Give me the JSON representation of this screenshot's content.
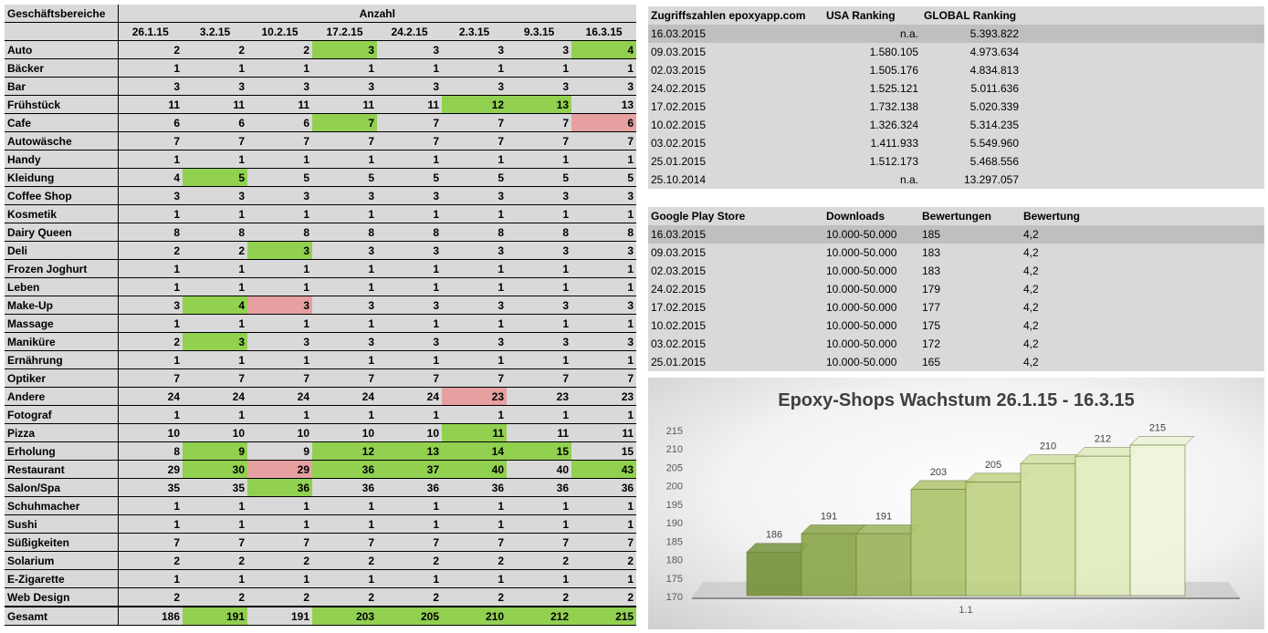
{
  "business_table": {
    "col_header": "Geschäftsbereiche",
    "group_header": "Anzahl",
    "dates": [
      "26.1.15",
      "3.2.15",
      "10.2.15",
      "17.2.15",
      "24.2.15",
      "2.3.15",
      "9.3.15",
      "16.3.15"
    ],
    "rows": [
      {
        "name": "Auto",
        "values": [
          2,
          2,
          2,
          3,
          3,
          3,
          3,
          4
        ],
        "hl": [
          "",
          "",
          "",
          "g",
          "",
          "",
          "",
          "g"
        ]
      },
      {
        "name": "Bäcker",
        "values": [
          1,
          1,
          1,
          1,
          1,
          1,
          1,
          1
        ],
        "hl": [
          "",
          "",
          "",
          "",
          "",
          "",
          "",
          ""
        ]
      },
      {
        "name": "Bar",
        "values": [
          3,
          3,
          3,
          3,
          3,
          3,
          3,
          3
        ],
        "hl": [
          "",
          "",
          "",
          "",
          "",
          "",
          "",
          ""
        ]
      },
      {
        "name": "Frühstück",
        "values": [
          11,
          11,
          11,
          11,
          11,
          12,
          13,
          13
        ],
        "hl": [
          "",
          "",
          "",
          "",
          "",
          "g",
          "g",
          ""
        ]
      },
      {
        "name": "Cafe",
        "values": [
          6,
          6,
          6,
          7,
          7,
          7,
          7,
          6
        ],
        "hl": [
          "",
          "",
          "",
          "g",
          "",
          "",
          "",
          "r"
        ]
      },
      {
        "name": "Autowäsche",
        "values": [
          7,
          7,
          7,
          7,
          7,
          7,
          7,
          7
        ],
        "hl": [
          "",
          "",
          "",
          "",
          "",
          "",
          "",
          ""
        ]
      },
      {
        "name": "Handy",
        "values": [
          1,
          1,
          1,
          1,
          1,
          1,
          1,
          1
        ],
        "hl": [
          "",
          "",
          "",
          "",
          "",
          "",
          "",
          ""
        ]
      },
      {
        "name": "Kleidung",
        "values": [
          4,
          5,
          5,
          5,
          5,
          5,
          5,
          5
        ],
        "hl": [
          "",
          "g",
          "",
          "",
          "",
          "",
          "",
          ""
        ]
      },
      {
        "name": "Coffee Shop",
        "values": [
          3,
          3,
          3,
          3,
          3,
          3,
          3,
          3
        ],
        "hl": [
          "",
          "",
          "",
          "",
          "",
          "",
          "",
          ""
        ]
      },
      {
        "name": "Kosmetik",
        "values": [
          1,
          1,
          1,
          1,
          1,
          1,
          1,
          1
        ],
        "hl": [
          "",
          "",
          "",
          "",
          "",
          "",
          "",
          ""
        ]
      },
      {
        "name": "Dairy Queen",
        "values": [
          8,
          8,
          8,
          8,
          8,
          8,
          8,
          8
        ],
        "hl": [
          "",
          "",
          "",
          "",
          "",
          "",
          "",
          ""
        ]
      },
      {
        "name": "Deli",
        "values": [
          2,
          2,
          3,
          3,
          3,
          3,
          3,
          3
        ],
        "hl": [
          "",
          "",
          "g",
          "",
          "",
          "",
          "",
          ""
        ]
      },
      {
        "name": "Frozen Joghurt",
        "values": [
          1,
          1,
          1,
          1,
          1,
          1,
          1,
          1
        ],
        "hl": [
          "",
          "",
          "",
          "",
          "",
          "",
          "",
          ""
        ]
      },
      {
        "name": "Leben",
        "values": [
          1,
          1,
          1,
          1,
          1,
          1,
          1,
          1
        ],
        "hl": [
          "",
          "",
          "",
          "",
          "",
          "",
          "",
          ""
        ]
      },
      {
        "name": "Make-Up",
        "values": [
          3,
          4,
          3,
          3,
          3,
          3,
          3,
          3
        ],
        "hl": [
          "",
          "g",
          "r",
          "",
          "",
          "",
          "",
          ""
        ]
      },
      {
        "name": "Massage",
        "values": [
          1,
          1,
          1,
          1,
          1,
          1,
          1,
          1
        ],
        "hl": [
          "",
          "",
          "",
          "",
          "",
          "",
          "",
          ""
        ]
      },
      {
        "name": "Maniküre",
        "values": [
          2,
          3,
          3,
          3,
          3,
          3,
          3,
          3
        ],
        "hl": [
          "",
          "g",
          "",
          "",
          "",
          "",
          "",
          ""
        ]
      },
      {
        "name": "Ernährung",
        "values": [
          1,
          1,
          1,
          1,
          1,
          1,
          1,
          1
        ],
        "hl": [
          "",
          "",
          "",
          "",
          "",
          "",
          "",
          ""
        ]
      },
      {
        "name": "Optiker",
        "values": [
          7,
          7,
          7,
          7,
          7,
          7,
          7,
          7
        ],
        "hl": [
          "",
          "",
          "",
          "",
          "",
          "",
          "",
          ""
        ]
      },
      {
        "name": "Andere",
        "values": [
          24,
          24,
          24,
          24,
          24,
          23,
          23,
          23
        ],
        "hl": [
          "",
          "",
          "",
          "",
          "",
          "r",
          "",
          ""
        ]
      },
      {
        "name": "Fotograf",
        "values": [
          1,
          1,
          1,
          1,
          1,
          1,
          1,
          1
        ],
        "hl": [
          "",
          "",
          "",
          "",
          "",
          "",
          "",
          ""
        ]
      },
      {
        "name": "Pizza",
        "values": [
          10,
          10,
          10,
          10,
          10,
          11,
          11,
          11
        ],
        "hl": [
          "",
          "",
          "",
          "",
          "",
          "g",
          "",
          ""
        ]
      },
      {
        "name": "Erholung",
        "values": [
          8,
          9,
          9,
          12,
          13,
          14,
          15,
          15
        ],
        "hl": [
          "",
          "g",
          "",
          "g",
          "g",
          "g",
          "g",
          ""
        ]
      },
      {
        "name": "Restaurant",
        "values": [
          29,
          30,
          29,
          36,
          37,
          40,
          40,
          43
        ],
        "hl": [
          "",
          "g",
          "r",
          "g",
          "g",
          "g",
          "",
          "g"
        ]
      },
      {
        "name": "Salon/Spa",
        "values": [
          35,
          35,
          36,
          36,
          36,
          36,
          36,
          36
        ],
        "hl": [
          "",
          "",
          "g",
          "",
          "",
          "",
          "",
          ""
        ]
      },
      {
        "name": "Schuhmacher",
        "values": [
          1,
          1,
          1,
          1,
          1,
          1,
          1,
          1
        ],
        "hl": [
          "",
          "",
          "",
          "",
          "",
          "",
          "",
          ""
        ]
      },
      {
        "name": "Sushi",
        "values": [
          1,
          1,
          1,
          1,
          1,
          1,
          1,
          1
        ],
        "hl": [
          "",
          "",
          "",
          "",
          "",
          "",
          "",
          ""
        ]
      },
      {
        "name": "Süßigkeiten",
        "values": [
          7,
          7,
          7,
          7,
          7,
          7,
          7,
          7
        ],
        "hl": [
          "",
          "",
          "",
          "",
          "",
          "",
          "",
          ""
        ]
      },
      {
        "name": "Solarium",
        "values": [
          2,
          2,
          2,
          2,
          2,
          2,
          2,
          2
        ],
        "hl": [
          "",
          "",
          "",
          "",
          "",
          "",
          "",
          ""
        ]
      },
      {
        "name": "E-Zigarette",
        "values": [
          1,
          1,
          1,
          1,
          1,
          1,
          1,
          1
        ],
        "hl": [
          "",
          "",
          "",
          "",
          "",
          "",
          "",
          ""
        ]
      },
      {
        "name": "Web Design",
        "values": [
          2,
          2,
          2,
          2,
          2,
          2,
          2,
          2
        ],
        "hl": [
          "",
          "",
          "",
          "",
          "",
          "",
          "",
          ""
        ]
      }
    ],
    "total": {
      "name": "Gesamt",
      "values": [
        186,
        191,
        191,
        203,
        205,
        210,
        212,
        215
      ],
      "hl": [
        "",
        "g",
        "",
        "g",
        "g",
        "g",
        "g",
        "g"
      ]
    }
  },
  "ranking_table": {
    "headers": [
      "Zugriffszahlen epoxyapp.com",
      "USA Ranking",
      "GLOBAL Ranking"
    ],
    "rows": [
      [
        "16.03.2015",
        "n.a.",
        "5.393.822"
      ],
      [
        "09.03.2015",
        "1.580.105",
        "4.973.634"
      ],
      [
        "02.03.2015",
        "1.505.176",
        "4.834.813"
      ],
      [
        "24.02.2015",
        "1.525.121",
        "5.011.636"
      ],
      [
        "17.02.2015",
        "1.732.138",
        "5.020.339"
      ],
      [
        "10.02.2015",
        "1.326.324",
        "5.314.235"
      ],
      [
        "03.02.2015",
        "1.411.933",
        "5.549.960"
      ],
      [
        "25.01.2015",
        "1.512.173",
        "5.468.556"
      ],
      [
        "25.10.2014",
        "n.a.",
        "13.297.057"
      ]
    ]
  },
  "play_table": {
    "headers": [
      "Google Play Store",
      "Downloads",
      "Bewertungen",
      "Bewertung"
    ],
    "rows": [
      [
        "16.03.2015",
        "10.000-50.000",
        "185",
        "4,2"
      ],
      [
        "09.03.2015",
        "10.000-50.000",
        "183",
        "4,2"
      ],
      [
        "02.03.2015",
        "10.000-50.000",
        "183",
        "4,2"
      ],
      [
        "24.02.2015",
        "10.000-50.000",
        "179",
        "4,2"
      ],
      [
        "17.02.2015",
        "10.000-50.000",
        "177",
        "4,2"
      ],
      [
        "10.02.2015",
        "10.000-50.000",
        "175",
        "4,2"
      ],
      [
        "03.02.2015",
        "10.000-50.000",
        "172",
        "4,2"
      ],
      [
        "25.01.2015",
        "10.000-50.000",
        "165",
        "4,2"
      ]
    ]
  },
  "chart_data": {
    "type": "bar",
    "title": "Epoxy-Shops Wachstum 26.1.15 - 16.3.15",
    "categories": [
      "1.1"
    ],
    "series": [
      {
        "values": [
          186
        ],
        "color": "#76923c"
      },
      {
        "values": [
          191
        ],
        "color": "#8aa64a"
      },
      {
        "values": [
          191
        ],
        "color": "#9bb35a"
      },
      {
        "values": [
          203
        ],
        "color": "#aec46c"
      },
      {
        "values": [
          205
        ],
        "color": "#bfd283"
      },
      {
        "values": [
          210
        ],
        "color": "#d0df9f"
      },
      {
        "values": [
          212
        ],
        "color": "#e0ebbd"
      },
      {
        "values": [
          215
        ],
        "color": "#edf4d8"
      }
    ],
    "yticks": [
      170,
      175,
      180,
      185,
      190,
      195,
      200,
      205,
      210,
      215
    ],
    "ylim": [
      170,
      215
    ],
    "grid": false
  }
}
